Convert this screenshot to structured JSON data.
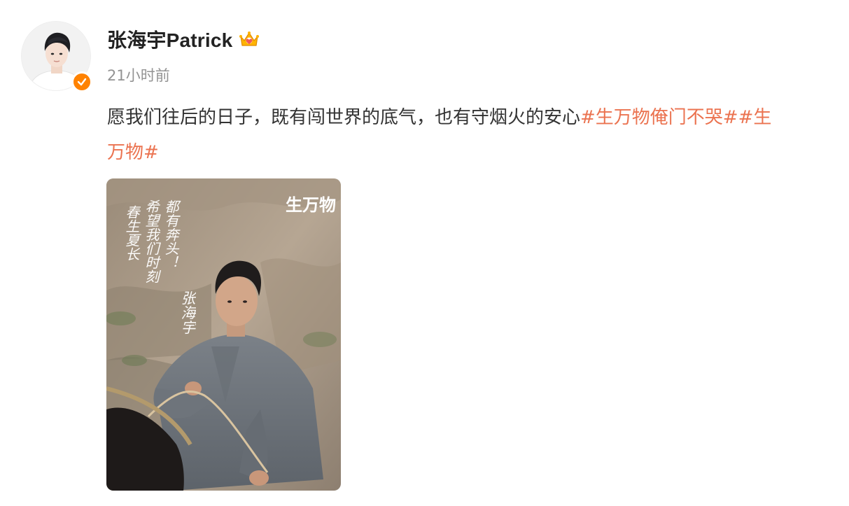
{
  "user": {
    "name": "张海宇Patrick",
    "time": "21小时前",
    "avatar_icon": "avatar",
    "verified_icon": "verified-check-icon",
    "crown_icon": "crown-icon",
    "verified_color": "#ff8200"
  },
  "post": {
    "text": "愿我们往后的日子，既有闯世界的底气，也有守烟火的安心",
    "hashtag1": "#生万物俺门不哭#",
    "hashtag2_part1": "#生",
    "hashtag2_part2": "万物#",
    "hashtag_color": "#eb7350"
  },
  "poster": {
    "logo_text": "生万物",
    "caption1": "春生夏长",
    "caption2": "希望我们时刻",
    "caption3": "都有奔头！",
    "signature": "张海宇"
  }
}
